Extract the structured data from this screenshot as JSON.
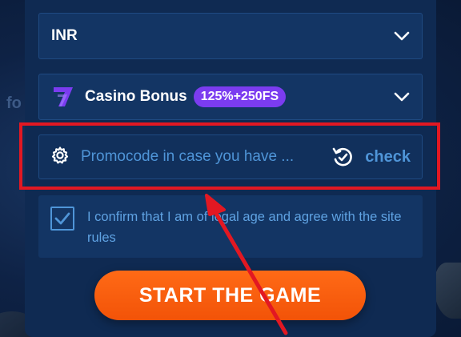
{
  "background": {
    "fragment_text": "fo"
  },
  "currency_select": {
    "value": "INR",
    "icon": "chevron-down-icon"
  },
  "bonus_select": {
    "logo": "casino-seven-logo-icon",
    "label": "Casino Bonus",
    "badge": "125%+250FS",
    "icon": "chevron-down-icon"
  },
  "promo": {
    "icon": "gear-icon",
    "placeholder": "Promocode in case you have ...",
    "check_icon": "refresh-check-icon",
    "check_label": "check"
  },
  "confirm": {
    "checked": true,
    "text": "I confirm that I am of legal age and agree with the site rules"
  },
  "start_button": {
    "label": "START THE GAME"
  },
  "colors": {
    "panel": "#0f2a52",
    "field": "#133564",
    "accent_blue": "#4f95d8",
    "badge_purple": "#7b3cf0",
    "cta_orange": "#f25308",
    "highlight_red": "#e21822"
  }
}
